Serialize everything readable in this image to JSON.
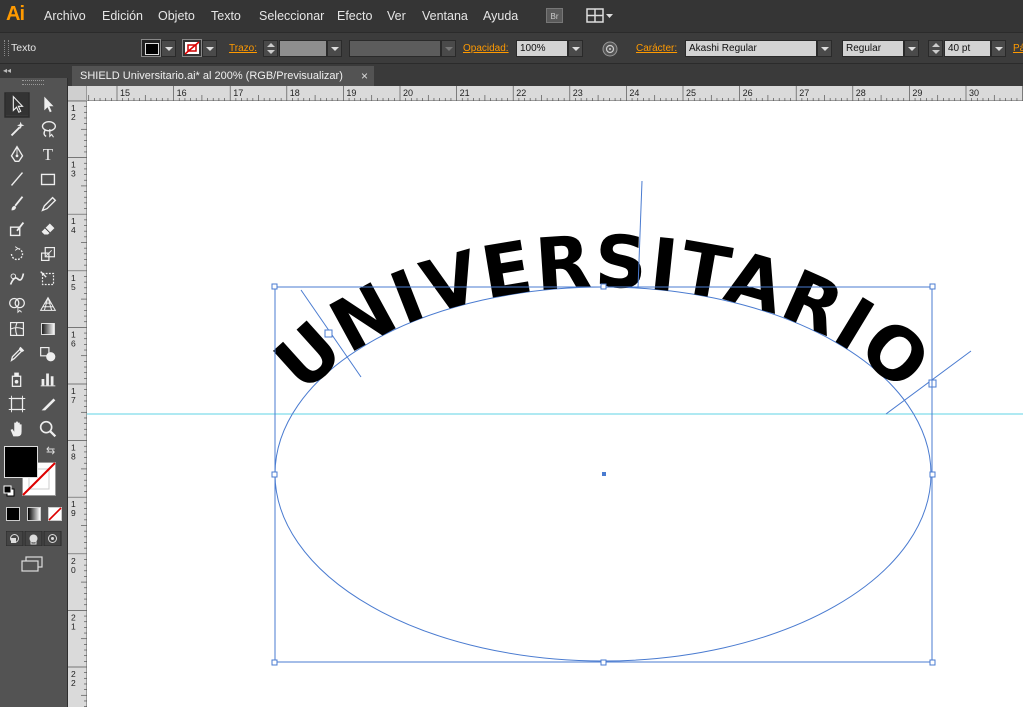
{
  "app": {
    "logo": "Ai"
  },
  "menu": {
    "items": [
      "Archivo",
      "Edición",
      "Objeto",
      "Texto",
      "Seleccionar",
      "Efecto",
      "Ver",
      "Ventana",
      "Ayuda"
    ],
    "bridge_label": "Br"
  },
  "control": {
    "tool_name": "Texto",
    "stroke_label": "Trazo:",
    "opacity_label": "Opacidad:",
    "opacity_value": "100%",
    "character_label": "Carácter:",
    "font_family": "Akashi Regular",
    "font_style": "Regular",
    "font_size": "40 pt",
    "paragraph_label": "Pá"
  },
  "tab": {
    "title": "SHIELD Universitario.ai* al 200% (RGB/Previsualizar)",
    "close": "×"
  },
  "rulers": {
    "horizontal": [
      "15",
      "16",
      "17",
      "18",
      "19",
      "20",
      "21",
      "22",
      "23",
      "24",
      "25",
      "26",
      "27",
      "28",
      "29",
      "30"
    ],
    "vertical": [
      "12",
      "13",
      "14",
      "15",
      "16",
      "17",
      "18",
      "19",
      "20",
      "21",
      "22"
    ]
  },
  "artwork": {
    "text": "UNIVERSITARIO",
    "selection_color": "#4a7bd0",
    "guide_color": "#5fd3e6"
  }
}
